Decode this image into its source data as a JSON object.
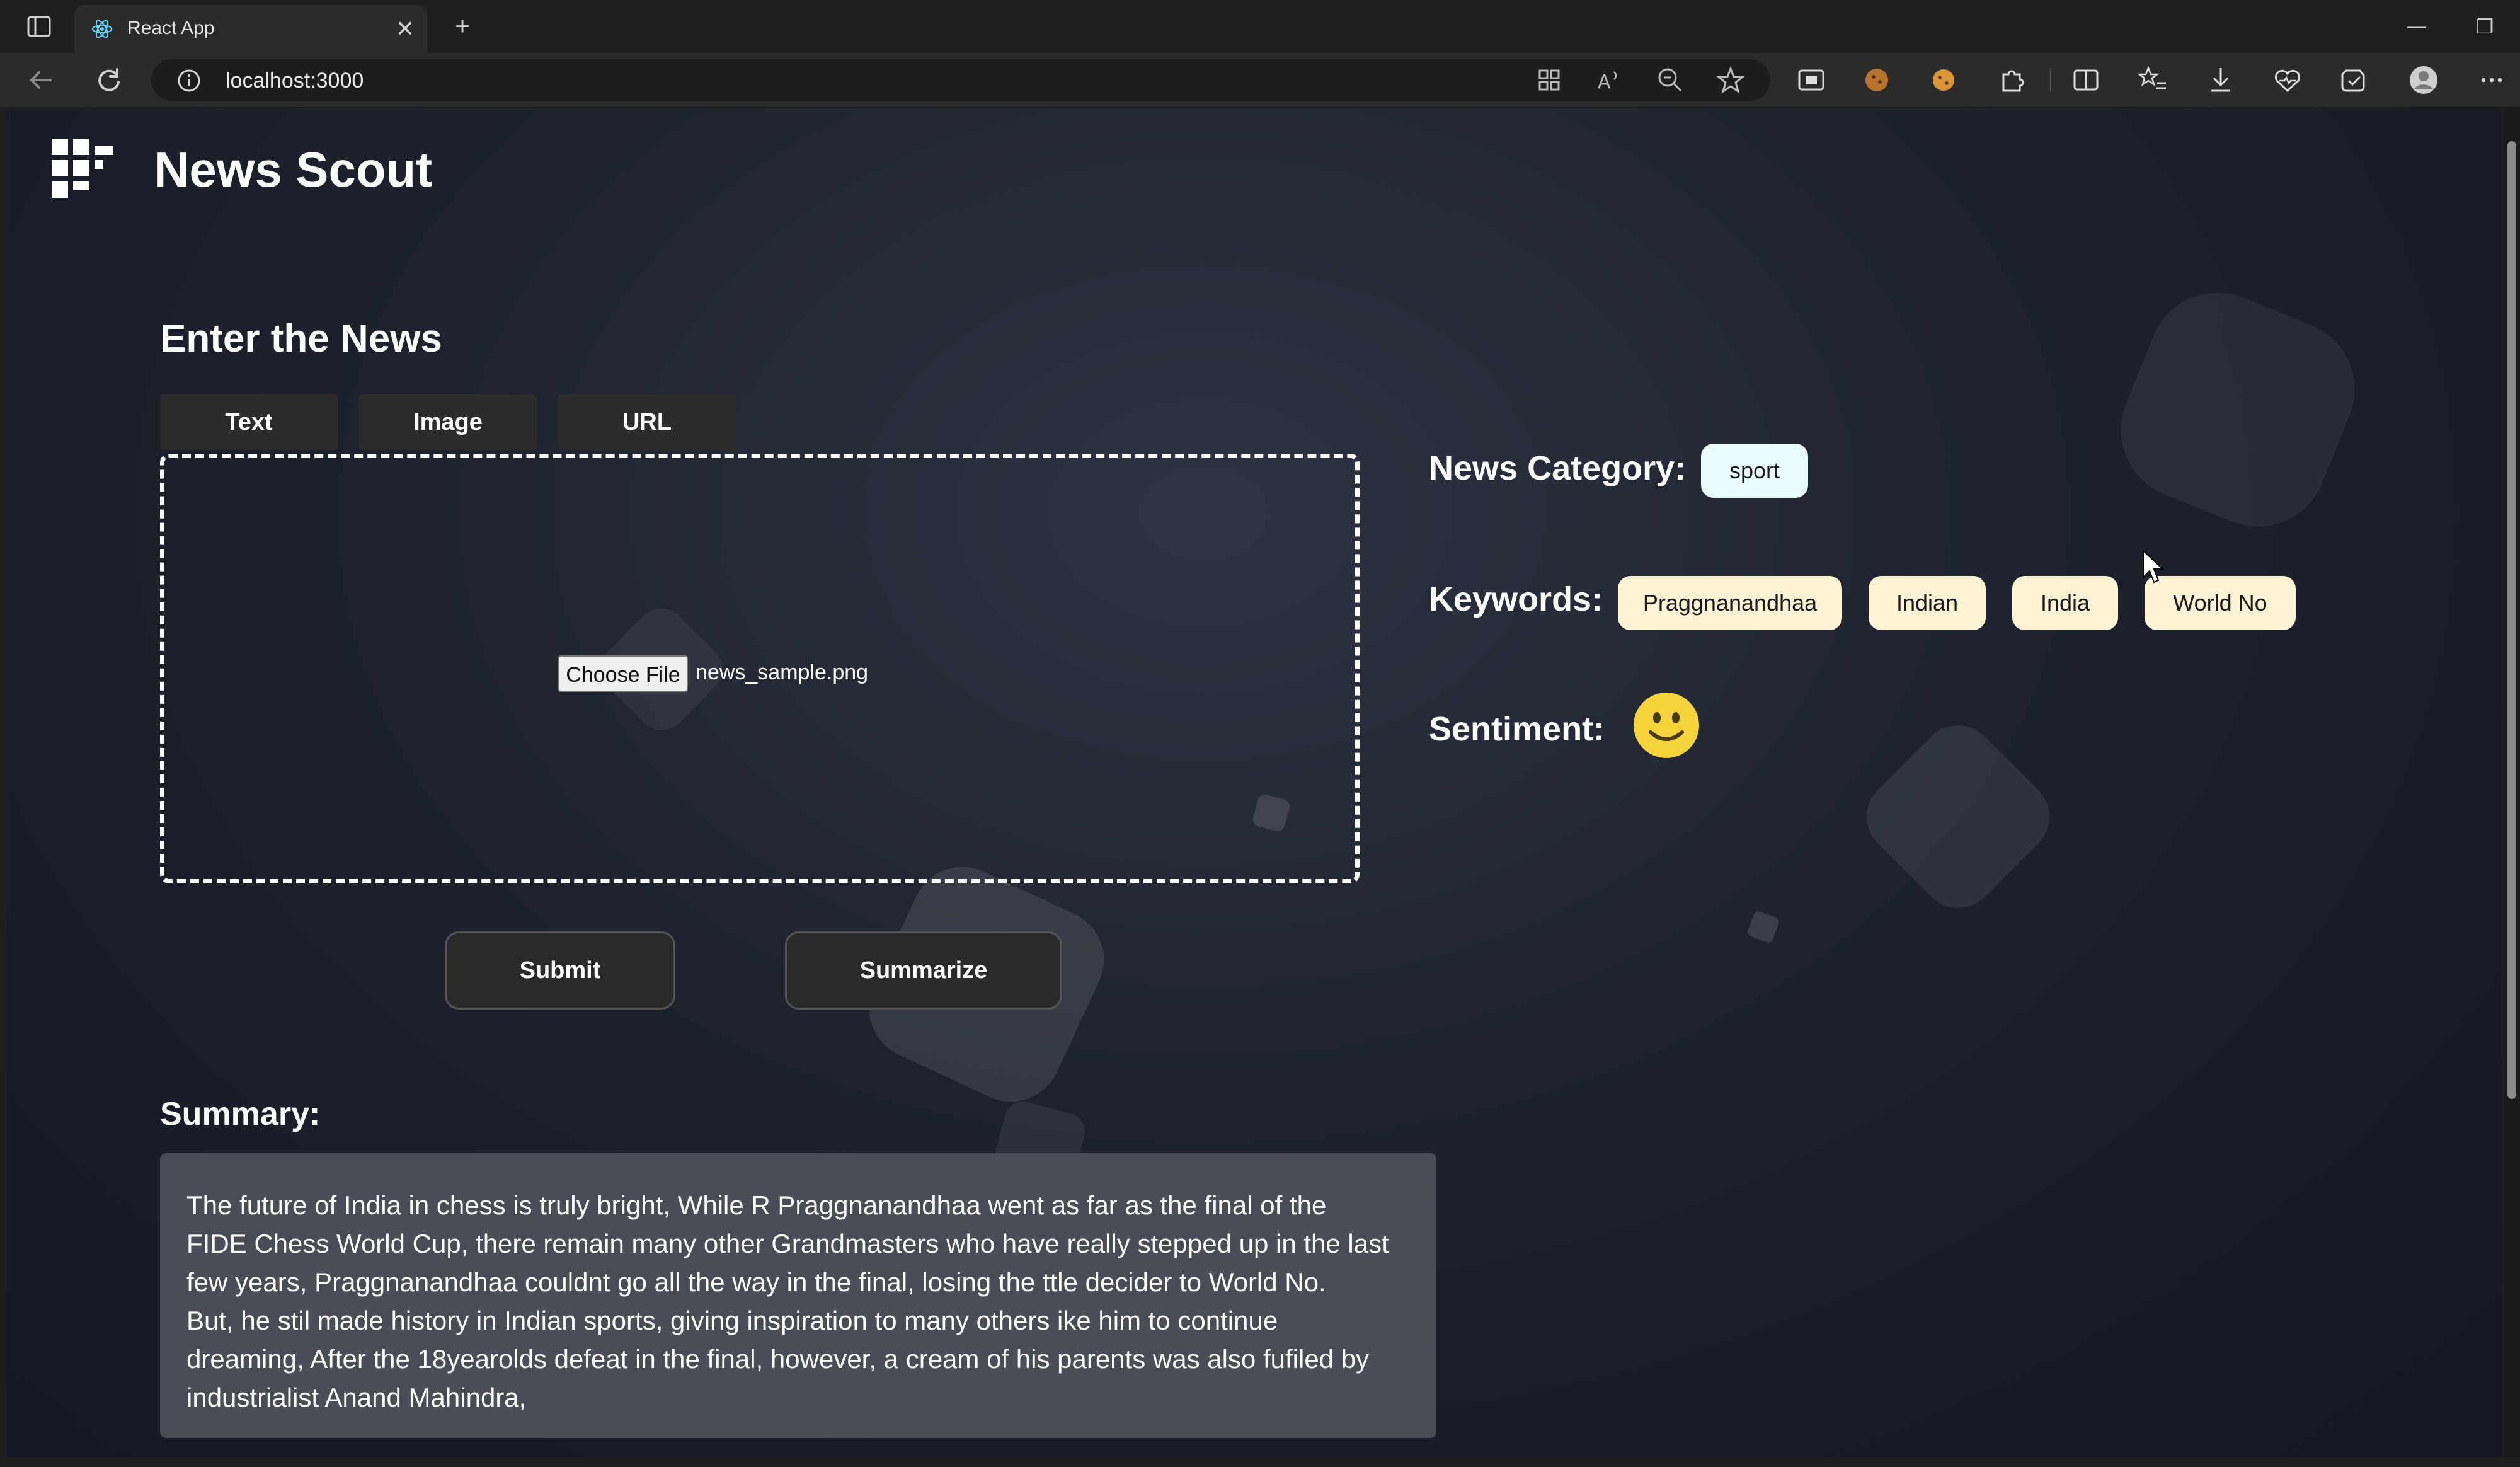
{
  "browser": {
    "tab_title": "React App",
    "tab_close": "✕",
    "new_tab": "+",
    "address": "localhost:3000",
    "window_minimize": "—",
    "window_restore": "❐"
  },
  "app": {
    "brand_title": "News Scout"
  },
  "input_section": {
    "heading": "Enter the News",
    "tabs": [
      {
        "label": "Text"
      },
      {
        "label": "Image"
      },
      {
        "label": "URL"
      }
    ],
    "choose_file_label": "Choose File",
    "file_name": "news_sample.png",
    "submit_label": "Submit",
    "summarize_label": "Summarize"
  },
  "results": {
    "category_label": "News Category:",
    "category_value": "sport",
    "keywords_label": "Keywords:",
    "keywords": [
      "Praggnanandhaa",
      "Indian",
      "India",
      "World No"
    ],
    "sentiment_label": "Sentiment:",
    "sentiment_icon": "smiley-face-icon"
  },
  "summary": {
    "heading": "Summary:",
    "lines": [
      "The future of India in chess is truly bright, While R Praggnanandhaa went as far as the final of the",
      "FIDE Chess World Cup, there remain many other Grandmasters who have really stepped up in the last",
      "few years, Praggnanandhaa couldnt go all the way in the final, losing the ttle decider to World No.",
      "But, he stil made history in Indian sports, giving inspiration to many others ike him to continue",
      "dreaming, After the 18yearolds defeat in the final, however, a cream of his parents was also fufiled by",
      "industrialist Anand Mahindra,"
    ]
  },
  "colors": {
    "category_pill": "#e8fbff",
    "keyword_pill": "#fff3d6",
    "emoji_yellow": "#f5d33b"
  }
}
